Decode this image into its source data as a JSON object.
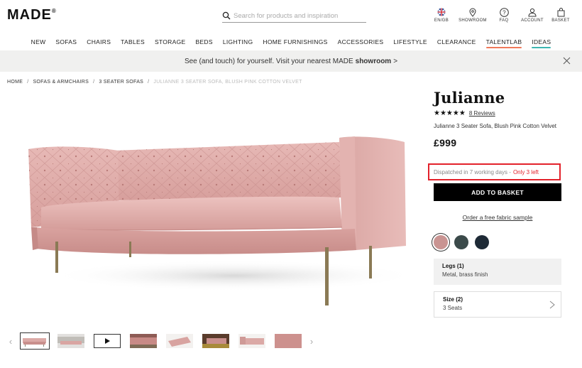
{
  "header": {
    "logo": "MADE",
    "logo_mark": "®",
    "search_placeholder": "Search for products and inspiration",
    "icons": [
      {
        "label": "EN/GB",
        "icon": "uk-flag-icon"
      },
      {
        "label": "SHOWROOM",
        "icon": "location-pin-icon"
      },
      {
        "label": "FAQ",
        "icon": "question-icon"
      },
      {
        "label": "ACCOUNT",
        "icon": "user-icon"
      },
      {
        "label": "BASKET",
        "icon": "basket-icon"
      }
    ]
  },
  "nav": {
    "items": [
      "NEW",
      "SOFAS",
      "CHAIRS",
      "TABLES",
      "STORAGE",
      "BEDS",
      "LIGHTING",
      "HOME FURNISHINGS",
      "ACCESSORIES",
      "LIFESTYLE",
      "CLEARANCE",
      "TALENTLAB",
      "IDEAS"
    ],
    "accent_talentlab": "#f0795a",
    "accent_ideas": "#3cb6b1"
  },
  "banner": {
    "text_before": "See (and touch) for yourself. Visit your nearest MADE",
    "bold": "showroom",
    "text_after": ">"
  },
  "breadcrumb": {
    "items": [
      "HOME",
      "SOFAS & ARMCHAIRS",
      "3 SEATER SOFAS"
    ],
    "current": "JULIANNE 3 SEATER SOFA, BLUSH PINK COTTON VELVET"
  },
  "product": {
    "title": "Julianne",
    "stars": "★★★★★",
    "reviews": "8 Reviews",
    "subtitle": "Julianne 3 Seater Sofa, Blush Pink Cotton Velvet",
    "price": "£999",
    "dispatch": "Dispatched in 7 working days -",
    "stock": "Only 3 left",
    "add_to_basket": "ADD TO BASKET",
    "fabric_sample": "Order a free fabric sample",
    "swatches": [
      "#c99492",
      "#3b4a4a",
      "#1e2a36"
    ],
    "legs_label": "Legs (1)",
    "legs_value": "Metal, brass finish",
    "size_label": "Size (2)",
    "size_value": "3 Seats",
    "alert_color": "#e3222b"
  }
}
